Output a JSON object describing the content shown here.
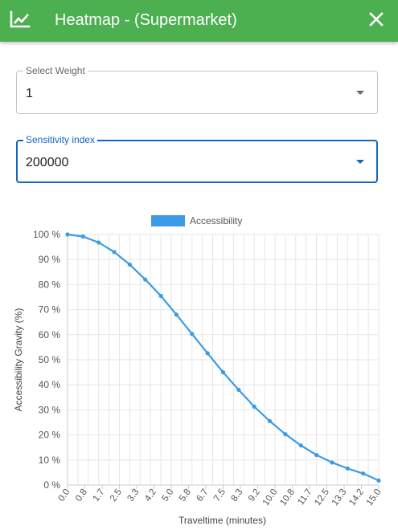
{
  "header": {
    "title": "Heatmap - (Supermarket)",
    "color": "#4caf50",
    "icons": {
      "logo": "line-chart-icon",
      "close": "close-icon"
    }
  },
  "weight_select": {
    "label": "Select Weight",
    "value": "1"
  },
  "sensitivity_select": {
    "label": "Sensitivity index",
    "value": "200000",
    "accent": "#1565c0"
  },
  "chart_data": {
    "type": "line",
    "xlabel": "Traveltime (minutes)",
    "ylabel": "Accessibility Gravity (%)",
    "legend": {
      "position": "top",
      "entries": [
        "Accessibility"
      ]
    },
    "series_color": "#3b9be6",
    "ylim": [
      0,
      100
    ],
    "yticks": [
      "0 %",
      "10 %",
      "20 %",
      "30 %",
      "40 %",
      "50 %",
      "60 %",
      "70 %",
      "80 %",
      "90 %",
      "100 %"
    ],
    "xlim": [
      0,
      15
    ],
    "xticks": [
      "0.0",
      "0.8",
      "1.7",
      "2.5",
      "3.3",
      "4.2",
      "5.0",
      "5.8",
      "6.7",
      "7.5",
      "8.3",
      "9.2",
      "10.0",
      "10.8",
      "11.7",
      "12.5",
      "13.3",
      "14.2",
      "15.0"
    ],
    "grid": true,
    "series": [
      {
        "name": "Accessibility",
        "x": [
          0,
          0.75,
          1.5,
          2.25,
          3,
          3.75,
          4.5,
          5.25,
          6,
          6.75,
          7.5,
          8.25,
          9,
          9.75,
          10.5,
          11.25,
          12,
          12.75,
          13.5,
          14.25,
          15
        ],
        "y": [
          100,
          99.2,
          96.8,
          93,
          88,
          82,
          75.5,
          68,
          60.3,
          52.6,
          45,
          38,
          31.3,
          25.5,
          20.3,
          15.8,
          12,
          9,
          6.6,
          4.6,
          1.8
        ]
      }
    ]
  }
}
